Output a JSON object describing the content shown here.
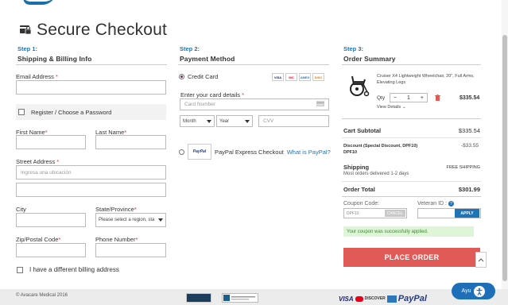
{
  "page": {
    "title": "Secure Checkout"
  },
  "step1": {
    "label": "Step 1:",
    "title": "Shipping & Billing Info",
    "email_label": "Email Address",
    "register_label": "Register / Choose a Password",
    "first_name_label": "First Name",
    "last_name_label": "Last Name",
    "street_label": "Street Address",
    "street_placeholder": "Ingresa una ubicación",
    "city_label": "City",
    "state_label": "State/Province",
    "state_value": "Please select a region, sta",
    "zip_label": "Zip/Postal Code",
    "phone_label": "Phone Number",
    "billing_label": "I have a different billing address"
  },
  "step2": {
    "label": "Step 2:",
    "title": "Payment Method",
    "credit_card_label": "Credit Card",
    "card_logos": [
      "VISA",
      "MC",
      "AMEX",
      "DISC"
    ],
    "card_details_label": "Enter your card details",
    "card_number_placeholder": "Card Number",
    "month_value": "Month",
    "year_value": "Year",
    "cvv_placeholder": "CVV",
    "paypal_badge": "PayPal",
    "paypal_label": "PayPal Express Checkout",
    "paypal_link": "What is PayPal?"
  },
  "step3": {
    "label": "Step 3:",
    "title": "Order Summary",
    "product_name": "Cruiser X4 Lightweight Wheelchair, 20\", Full Arms, Elevating Legs",
    "qty_label": "Qty",
    "qty_value": "1",
    "qty_minus": "−",
    "qty_plus": "+",
    "product_price": "$335.54",
    "view_details": "View Details",
    "subtotal_label": "Cart Subtotal",
    "subtotal_value": "$335.54",
    "discount_label": "Discount (Special Discount, DPF10) DPF10",
    "discount_value": "-$33.55",
    "shipping_label": "Shipping",
    "shipping_value": "FREE SHIPPING",
    "shipping_note": "Most orders delivered 1-2 days",
    "total_label": "Order Total",
    "total_value": "$301.99",
    "coupon_label": "Coupon Code:",
    "coupon_value": "DPF10",
    "cancel_label": "CANCEL",
    "veteran_label": "Veteran ID :",
    "apply_label": "APPLY",
    "success_message": "Your coupon was successfully applied.",
    "place_order_label": "PLACE ORDER"
  },
  "footer": {
    "copyright": "© Avacare Medical 2016",
    "payment_marks": "VISA",
    "discover_mark": "DISCOVER",
    "paypal_mark": "PayPal"
  },
  "chat": {
    "label": "Ayu"
  },
  "colors": {
    "accent": "#1f74b7",
    "place_order": "#e05a57",
    "required": "#d9363e",
    "success_bg": "#dff5d8"
  }
}
